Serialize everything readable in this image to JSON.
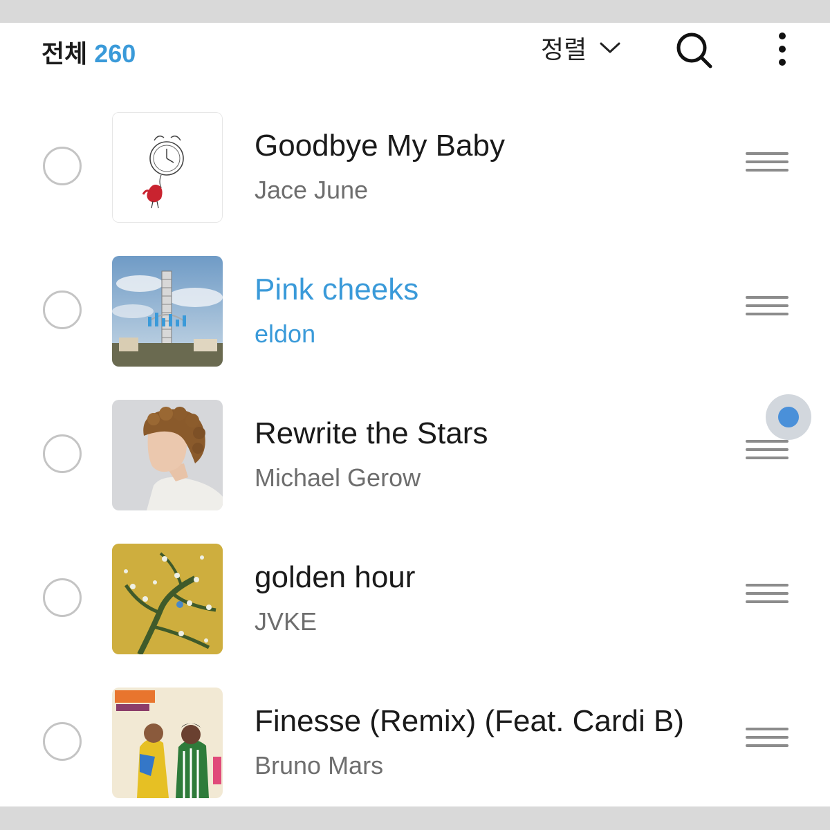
{
  "header": {
    "count_label": "전체",
    "count_value": "260",
    "sort_label": "정렬",
    "icons": {
      "sort": "chevron-down-icon",
      "search": "search-icon",
      "more": "more-vertical-icon"
    }
  },
  "songs": [
    {
      "title": "Goodbye My Baby",
      "artist": "Jace June",
      "playing": false,
      "art": "clock-sketch-art"
    },
    {
      "title": "Pink cheeks",
      "artist": "eldon",
      "playing": true,
      "art": "ferris-wheel-art"
    },
    {
      "title": "Rewrite the Stars",
      "artist": "Michael Gerow",
      "playing": false,
      "art": "portrait-art"
    },
    {
      "title": "golden hour",
      "artist": "JVKE",
      "playing": false,
      "art": "almond-blossom-art"
    },
    {
      "title": "Finesse (Remix) (Feat. Cardi B)",
      "artist": "Bruno Mars",
      "playing": false,
      "art": "finesse-art"
    }
  ],
  "colors": {
    "accent": "#3a9ad9",
    "text": "#1a1a1a",
    "muted": "#6e6e6e"
  }
}
